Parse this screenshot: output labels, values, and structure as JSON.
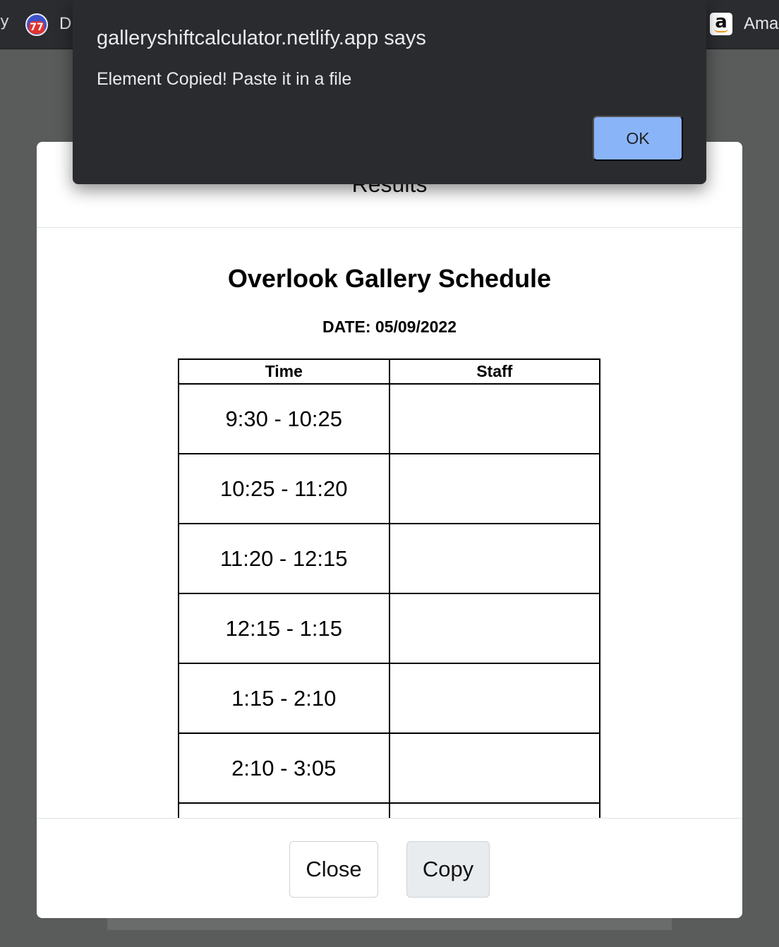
{
  "browser": {
    "edge_glyph": "y",
    "bookmarks": [
      {
        "icon": "77-badge-icon",
        "badge_text": "77",
        "label": "D"
      },
      {
        "icon": "amazon-icon",
        "icon_text": "a",
        "label": "Ama"
      }
    ]
  },
  "alert": {
    "title": "galleryshiftcalculator.netlify.app says",
    "message": "Element Copied! Paste it in a file",
    "ok_label": "OK"
  },
  "modal": {
    "title": "Results",
    "schedule_title": "Overlook Gallery Schedule",
    "date_line": "DATE: 05/09/2022",
    "table": {
      "headers": [
        "Time",
        "Staff"
      ],
      "rows": [
        {
          "time": "9:30 - 10:25",
          "staff": ""
        },
        {
          "time": "10:25 - 11:20",
          "staff": ""
        },
        {
          "time": "11:20 - 12:15",
          "staff": ""
        },
        {
          "time": "12:15 - 1:15",
          "staff": ""
        },
        {
          "time": "1:15 - 2:10",
          "staff": ""
        },
        {
          "time": "2:10 - 3:05",
          "staff": ""
        },
        {
          "time": "",
          "staff": ""
        }
      ]
    },
    "footer": {
      "close_label": "Close",
      "copy_label": "Copy"
    }
  },
  "colors": {
    "alert_bg": "#2a2b2f",
    "ok_button": "#8ab4f8",
    "backdrop": "#5a5b5b"
  }
}
